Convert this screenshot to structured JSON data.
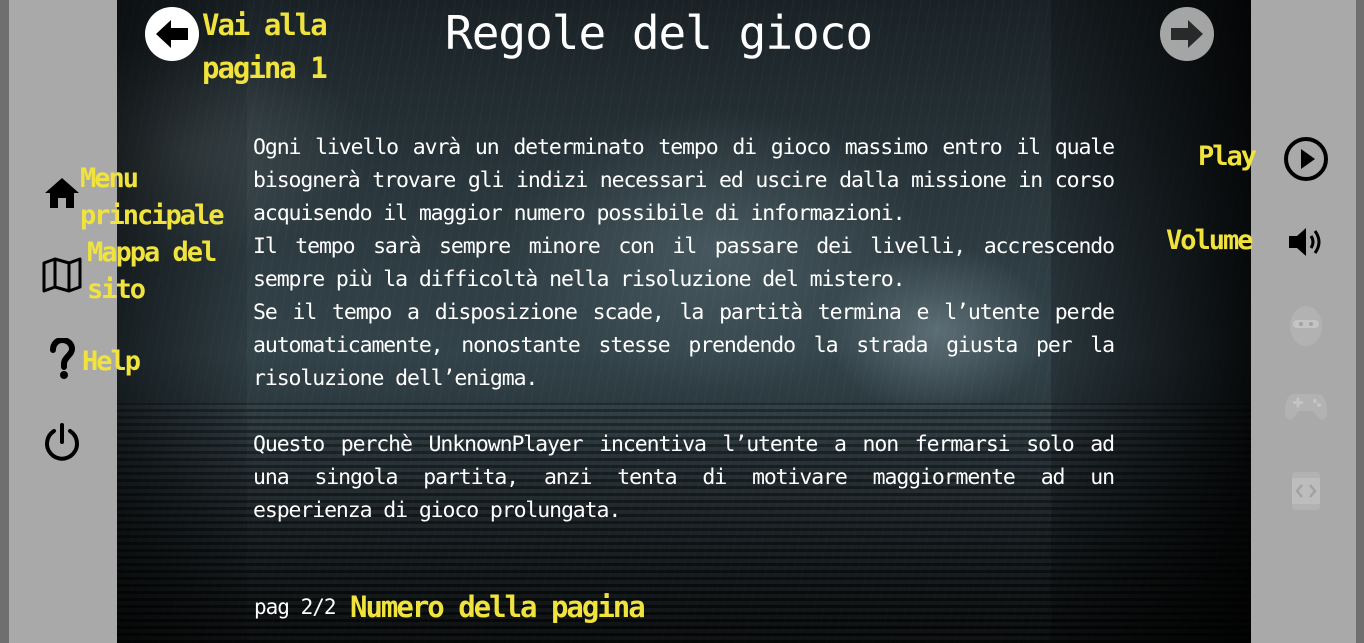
{
  "page": {
    "title": "Regole del gioco",
    "back_label": "Vai alla pagina 1",
    "page_number": "pag 2/2",
    "page_number_label": "Numero della pagina"
  },
  "content": {
    "paragraphs": [
      "Ogni livello avrà un determinato tempo di gioco massimo entro il quale bisognerà trovare gli indizi necessari ed uscire dalla missione in corso acquisendo il maggior numero possibile di informazioni.",
      "Il tempo sarà sempre minore con il passare dei livelli, accrescendo sempre più la difficoltà nella risoluzione del mistero.",
      "Se il tempo a disposizione scade, la partità termina e l’utente perde automaticamente, nonostante stesse prendendo la strada giusta per la risoluzione dell’enigma.",
      "Questo perchè UnknownPlayer incentiva l’utente a non fermarsi solo ad una singola partita, anzi tenta di motivare maggiormente ad un esperienza di gioco prolungata."
    ]
  },
  "left_menu": {
    "home_label": "Menu principale",
    "map_label": "Mappa del sito",
    "help_label": "Help"
  },
  "right_menu": {
    "play_label": "Play",
    "volume_label": "Volume"
  },
  "icons": {
    "back": "arrow-left-icon",
    "next": "arrow-right-icon",
    "home": "home-icon",
    "map": "map-icon",
    "help": "question-icon",
    "power": "power-icon",
    "play": "play-circle-icon",
    "volume": "volume-icon",
    "ninja": "ninja-icon",
    "gamepad": "gamepad-icon",
    "code": "code-icon"
  },
  "colors": {
    "accent_yellow": "#f1e33d",
    "text": "#ffffff",
    "side_panel": "#a9a9a9"
  }
}
